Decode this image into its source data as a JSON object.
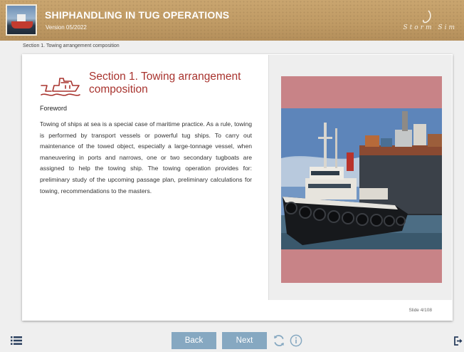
{
  "header": {
    "title": "SHIPHANDLING IN TUG OPERATIONS",
    "version": "Version 05/2022",
    "brand_text": "Storm Sim"
  },
  "breadcrumb": "Section 1. Towing arrangement composition",
  "section": {
    "heading": "Section 1. Towing arrangement composition",
    "subheading": "Foreword",
    "body": "Towing of ships at sea is a special case of maritime practice. As a rule, towing is performed by transport vessels or powerful tug ships. To carry out maintenance of the towed object, especially a large-tonnage vessel, when maneuvering in ports and narrows, one or two secondary tugboats are assigned to help the towing ship. The towing operation provides for: preliminary study of the upcoming passage plan, preliminary calculations for towing, recommendations to the masters."
  },
  "slide_counter": "Slide 4/108",
  "nav": {
    "back_label": "Back",
    "next_label": "Next"
  },
  "icons": {
    "menu": "menu-list-icon",
    "reload": "reload-icon",
    "info": "info-icon",
    "exit": "exit-icon",
    "section": "tug-ship-icon"
  },
  "colors": {
    "header": "#c9a56f",
    "accent": "#a8332e",
    "button": "#86a8c1",
    "image_frame": "#c88387"
  }
}
